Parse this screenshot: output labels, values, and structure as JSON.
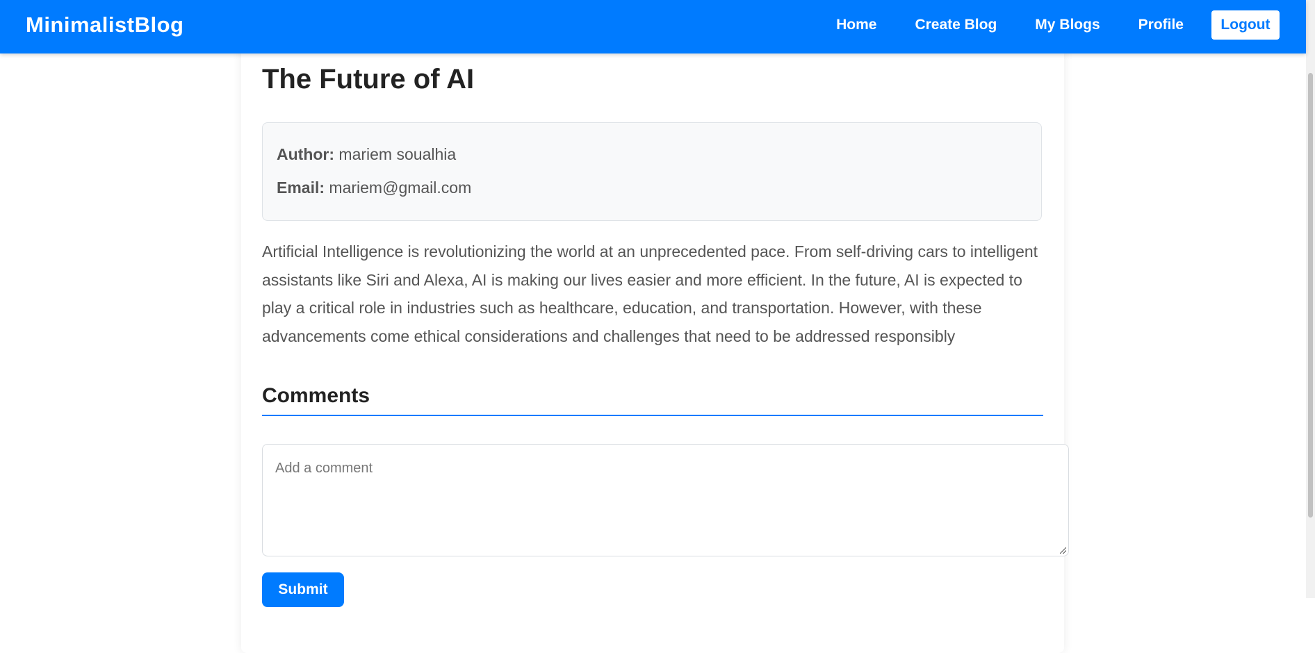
{
  "navbar": {
    "brand": "MinimalistBlog",
    "links": [
      {
        "label": "Home"
      },
      {
        "label": "Create Blog"
      },
      {
        "label": "My Blogs"
      },
      {
        "label": "Profile"
      }
    ],
    "logout_label": "Logout"
  },
  "post": {
    "title": "The Future of AI",
    "author_label": "Author:",
    "author": "mariem soualhia",
    "email_label": "Email:",
    "email": "mariem@gmail.com",
    "content": "Artificial Intelligence is revolutionizing the world at an unprecedented pace. From self-driving cars to intelligent assistants like Siri and Alexa, AI is making our lives easier and more efficient. In the future, AI is expected to play a critical role in industries such as healthcare, education, and transportation. However, with these advancements come ethical considerations and challenges that need to be addressed responsibly"
  },
  "comments": {
    "heading": "Comments",
    "input_placeholder": "Add a comment",
    "input_value": "",
    "submit_label": "Submit"
  },
  "colors": {
    "accent": "#007bff",
    "meta_bg": "#f8f9fa",
    "text_muted": "#555555"
  }
}
